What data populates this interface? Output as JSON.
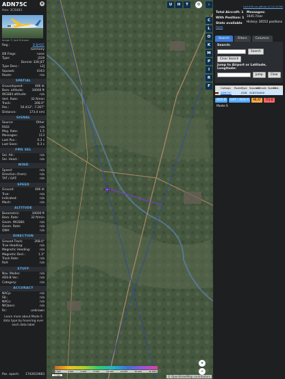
{
  "left_panel": {
    "callsign": "ADN75C",
    "hex": "Hex: 3C6483",
    "photo_credit": "Image © Jack Ericsson",
    "reg": {
      "k": "Reg.:",
      "v": "D-BADC"
    },
    "country": {
      "k": "",
      "v": "Germany"
    },
    "db_flags": {
      "k": "DB Flags:",
      "v": "none"
    },
    "type": {
      "k": "Type:",
      "v": "J328"
    },
    "type_full": {
      "k": "",
      "v": "Dornier 328 JET"
    },
    "type_desc": {
      "k": "Type Desc.:",
      "v": "L2J"
    },
    "squawk": {
      "k": "Squawk:",
      "v": "4163"
    },
    "route": {
      "k": "Route:",
      "v": "n/a"
    },
    "sections": {
      "spatial": "SPATIAL",
      "signal": "SIGNAL",
      "fms": "FMS SEL",
      "wind": "WIND",
      "speed": "SPEED",
      "altitude": "ALTITUDE",
      "direction": "DIRECTION",
      "stuff": "STUFF",
      "accuracy": "ACCURACY"
    },
    "spatial_rows": [
      {
        "k": "Groundspeed:",
        "v": "406 kt"
      },
      {
        "k": "Baro. altitude:",
        "v": "34000 ft"
      },
      {
        "k": "WGS84 altitude:",
        "v": "n/a"
      },
      {
        "k": "Vert. Rate:",
        "v": "32 ft/min"
      },
      {
        "k": "Track:",
        "v": "268.0°"
      },
      {
        "k": "Pos.:",
        "v": "50.412°, 7.267°"
      },
      {
        "k": "Distance:",
        "v": "173.4 nmi"
      }
    ],
    "signal_rows": [
      {
        "k": "Source:",
        "v": "Other"
      },
      {
        "k": "RSSI:",
        "v": "n/a"
      },
      {
        "k": "Msg. Rate:",
        "v": "1.5"
      },
      {
        "k": "Messages:",
        "v": "113"
      },
      {
        "k": "Last Pos.:",
        "v": "0.3 s"
      },
      {
        "k": "Last Seen:",
        "v": "0.3 s"
      }
    ],
    "fms_rows": [
      {
        "k": "Sel. Alt.:",
        "v": "n/a"
      },
      {
        "k": "Sel. Head.:",
        "v": "n/a"
      }
    ],
    "wind_rows": [
      {
        "k": "Speed:",
        "v": "n/a"
      },
      {
        "k": "Direction (from):",
        "v": "n/a"
      },
      {
        "k": "TAT / OAT:",
        "v": "n/a"
      }
    ],
    "speed_rows": [
      {
        "k": "Ground:",
        "v": "406 kt"
      },
      {
        "k": "True:",
        "v": "n/a"
      },
      {
        "k": "Indicated:",
        "v": "n/a"
      },
      {
        "k": "Mach:",
        "v": "n/a"
      }
    ],
    "altitude_rows": [
      {
        "k": "Barometric:",
        "v": "34000 ft"
      },
      {
        "k": "Baro. Rate:",
        "v": "32 ft/min"
      },
      {
        "k": "Geom. WGS84:",
        "v": "n/a"
      },
      {
        "k": "Geom. Rate:",
        "v": "n/a"
      },
      {
        "k": "QNH:",
        "v": "n/a"
      }
    ],
    "direction_rows": [
      {
        "k": "Ground Track:",
        "v": "268.0°"
      },
      {
        "k": "True Heading:",
        "v": "n/a"
      },
      {
        "k": "Magnetic Heading:",
        "v": "n/a"
      },
      {
        "k": "Magnetic Decl.:",
        "v": "1.3°"
      },
      {
        "k": "Track Rate:",
        "v": "n/a"
      },
      {
        "k": "Roll:",
        "v": "n/a"
      }
    ],
    "stuff_rows": [
      {
        "k": "Nav. Modes:",
        "v": "n/a"
      },
      {
        "k": "ADS-B Ver.:",
        "v": "n/a"
      },
      {
        "k": "Category:",
        "v": "n/a"
      }
    ],
    "accuracy_rows": [
      {
        "k": "NACp:",
        "v": "n/a"
      },
      {
        "k": "SIL:",
        "v": "n/a"
      },
      {
        "k": "NACv:",
        "v": "n/a"
      },
      {
        "k": "NICbaro:",
        "v": "n/a"
      },
      {
        "k": "Rc:",
        "v": "unknown"
      }
    ],
    "note": "Learn more about Mode S data type by hovering over each data label",
    "pos_epoch": {
      "k": "Pos. epoch:",
      "v": "1742633683"
    }
  },
  "map": {
    "top_buttons": [
      "U",
      "H",
      "T"
    ],
    "side_buttons": [
      "C",
      "L",
      "O",
      "K",
      "M",
      "P",
      "I",
      "R",
      "F"
    ],
    "zoom_in": "+",
    "zoom_out": "−",
    "scale_label": "2 NM",
    "alt_labels": [
      "2 000",
      "4 000",
      "6 000",
      "8 000",
      "10 000",
      "20 000",
      "30 000",
      "40 000+"
    ],
    "attribution": "© OpenStreetMap contributors"
  },
  "right_panel": {
    "top_link": "tar1090 on github (2.14.1176)",
    "stats_left": [
      "Total Aircraft: 1",
      "With Position: 1",
      "Stats available"
    ],
    "stats_link": "here",
    "stats_right_title": "Messages:",
    "stats_right_rate": "1645.7/sec",
    "stats_history": "History: 26552 positions",
    "tabs": [
      "Search",
      "Filters",
      "Columns"
    ],
    "search_label": "Search:",
    "search_btn": "Search",
    "clear_search_btn": "Clear Search",
    "jump_label": "Jump to Airport or Latitude, Longitude:",
    "jump_btn": "Jump",
    "clear_btn": "Clear",
    "table_headers": [
      "",
      "Callsign",
      "Route",
      "Type",
      "Squawk",
      "Altitude",
      "Speed",
      "Dist."
    ],
    "table_rows": [
      {
        "flag": "",
        "callsign": "ADN75C",
        "route": "",
        "type": "J328",
        "squawk": "4163",
        "alt": "34000",
        "speed": "",
        "dist": ""
      }
    ],
    "legend": [
      "ADS-B",
      "UAT / ADS-R",
      "MLAT",
      "TIS-B",
      "Mode-S"
    ]
  }
}
